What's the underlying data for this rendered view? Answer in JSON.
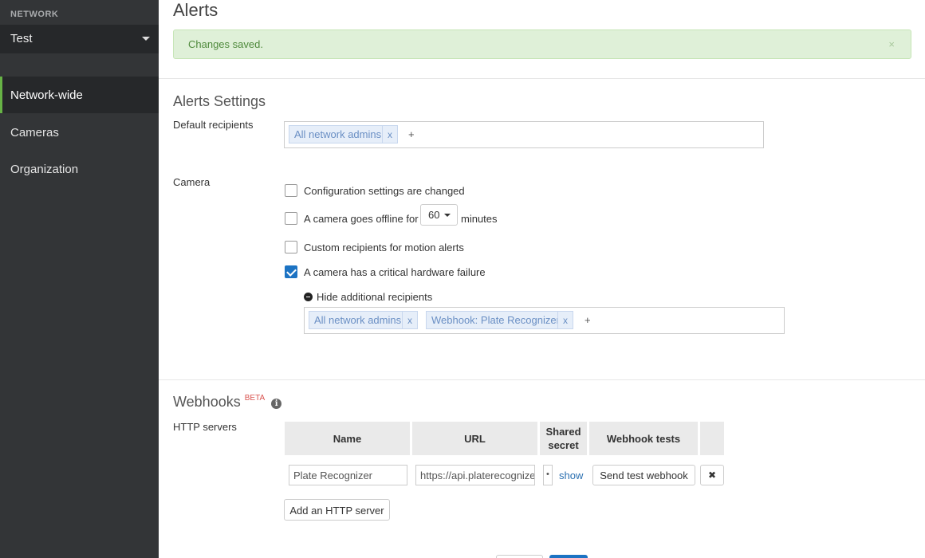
{
  "sidebar": {
    "section_label": "NETWORK",
    "network_name": "Test",
    "items": [
      {
        "label": "Network-wide",
        "active": true
      },
      {
        "label": "Cameras",
        "active": false
      },
      {
        "label": "Organization",
        "active": false
      }
    ]
  },
  "page": {
    "title": "Alerts",
    "alert_message": "Changes saved.",
    "alert_close": "×"
  },
  "alerts_settings": {
    "title": "Alerts Settings",
    "default_recipients_label": "Default recipients",
    "default_recipients": [
      "All network admins"
    ],
    "token_remove": "x",
    "token_add": "+"
  },
  "camera": {
    "label": "Camera",
    "options": [
      {
        "label": "Configuration settings are changed",
        "checked": false
      },
      {
        "label": "A camera goes offline for",
        "checked": false,
        "select_value": "60",
        "suffix": "minutes"
      },
      {
        "label": "Custom recipients for motion alerts",
        "checked": false
      },
      {
        "label": "A camera has a critical hardware failure",
        "checked": true
      }
    ],
    "hide_recipients_label": "Hide additional recipients",
    "additional_recipients": [
      "All network admins",
      "Webhook: Plate Recognizer"
    ]
  },
  "webhooks": {
    "title": "Webhooks",
    "beta_label": "BETA",
    "info_icon": "i",
    "http_servers_label": "HTTP servers",
    "columns": [
      "Name",
      "URL",
      "Shared secret",
      "Webhook tests"
    ],
    "rows": [
      {
        "name": "Plate Recognizer",
        "url": "https://api.platerecognizer.com",
        "secret": "•",
        "show_label": "show",
        "test_label": "Send test webhook",
        "delete_label": "✖"
      }
    ],
    "add_server_label": "Add an HTTP server"
  },
  "colors": {
    "sidebar_bg": "#333537",
    "active_accent": "#67b346",
    "success_bg": "#dff0d8",
    "token_bg": "#e6eef9",
    "checkbox_checked": "#1c73c3"
  }
}
